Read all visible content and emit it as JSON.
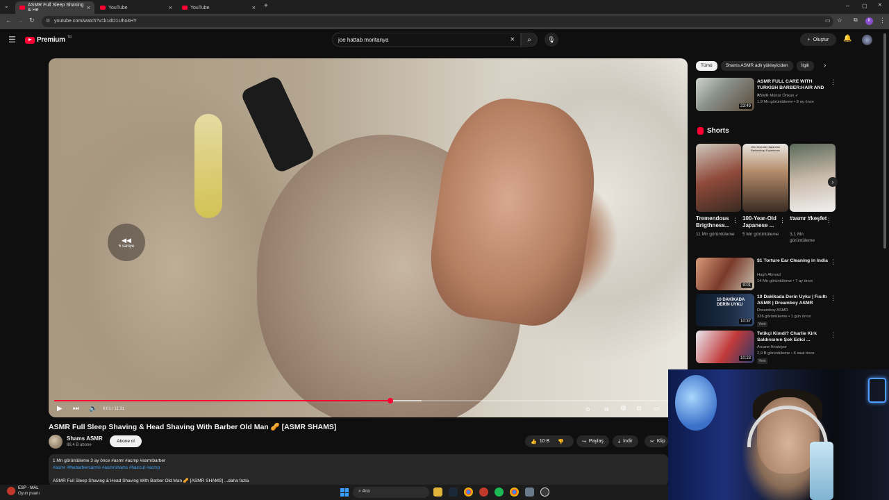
{
  "browser": {
    "tabs": [
      {
        "title": "ASMR Full Sleep Shaving & He",
        "active": true
      },
      {
        "title": "YouTube",
        "active": false
      },
      {
        "title": "YouTube",
        "active": false
      }
    ],
    "url": "youtube.com/watch?v=k1dO1Uho4HY"
  },
  "header": {
    "logo_text": "Premium",
    "logo_sup": "TR",
    "search_value": "joe hattab moritanya",
    "create_label": "Oluştur"
  },
  "player": {
    "seek_overlay_label": "5 saniye",
    "time": "6:01 / 11:31",
    "progress": 0.535,
    "buffered_to": 0.585
  },
  "video": {
    "title": "ASMR Full Sleep Shaving & Head Shaving With Barber Old Man 🥜 [ASMR SHAMS]",
    "channel": "Shams ASMR",
    "subscribers": "88,4 B abone",
    "subscribe_label": "Abone ol",
    "likes": "10 B",
    "share_label": "Paylaş",
    "download_label": "İndir",
    "clip_label": "Klip",
    "description": {
      "line1": "1 Mn görüntüleme  3 ay önce  #asmr #acmp #asmrbarber",
      "tags": "#asmr #thebarbersarms #asmrshams #haircut #acmp",
      "line3": "ASMR Full Sleep Shaving & Head Shaving With Barber Old Man 🥜 [ASMR SHAMS] ...daha fazla"
    }
  },
  "sidebar": {
    "chips": [
      "Tümü",
      "Shams ASMR adlı yükleyiciden",
      "İlgili"
    ],
    "top_video": {
      "title": "ASMR FULL CARE WITH TURKISH BARBER:HAIR AND ...",
      "channel": "ASMR Münür Önkan",
      "meta": "1,9 Mn görüntüleme • 8 ay önce",
      "duration": "23:49"
    },
    "shorts_title": "Shorts",
    "shorts": [
      {
        "title": "Tremendous Brigthness...",
        "views": "11 Mn görüntüleme"
      },
      {
        "title": "100-Year-Old Japanese ...",
        "views": "5 Mn görüntüleme"
      },
      {
        "title": "#asmr #keşfet",
        "views": "3,1 Mn görüntüleme"
      }
    ],
    "shorts_thumb_caption": "100-Year-Old Japanese Barbershop Experience",
    "videos": [
      {
        "title": "$1 Torture Ear Cleaning in India",
        "channel": "Hugh Abroad",
        "meta": "14 Mn görüntüleme • 7 ay önce",
        "duration": "9:01",
        "badge": "",
        "thumb_text": ""
      },
      {
        "title": "10 Dakikada Derin Uyku | Fısıltı ASMR | Dreamboy ASMR",
        "channel": "Dreamboy ASMR",
        "meta": "326 görüntüleme • 1 gün önce",
        "duration": "10:37",
        "badge": "Yeni",
        "thumb_text": "10 DAKİKADA DERİN UYKU"
      },
      {
        "title": "Tetikçi Kimdi? Charlie Kirk Saldırısının Şok Edici ...",
        "channel": "Arcane Anatoyor",
        "meta": "2,9 B görüntüleme • 6 saat önce",
        "duration": "10:23",
        "badge": "Yeni",
        "thumb_text": ""
      }
    ]
  },
  "taskbar": {
    "weather_line1": "ESP - MAL",
    "weather_line2": "Oyun puanı",
    "search_placeholder": "Ara"
  }
}
